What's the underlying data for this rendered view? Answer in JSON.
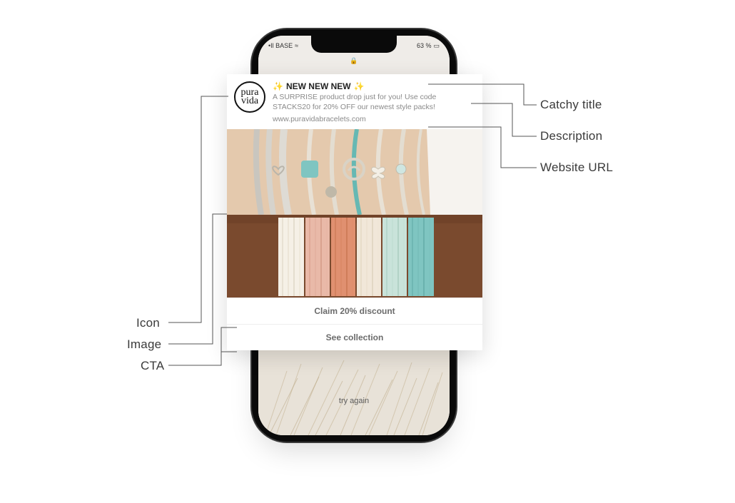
{
  "status_bar": {
    "carrier": "•Il BASE",
    "wifi_glyph": "≈",
    "battery_text": "63 %",
    "battery_glyph": "▭"
  },
  "phone_ui": {
    "lock_glyph": "🔒",
    "try_again": "try again"
  },
  "brand": {
    "line1": "pura",
    "line2": "vida"
  },
  "notification": {
    "sparkle": "✨",
    "title": "NEW NEW NEW",
    "description": "A SURPRISE product drop just for you! Use code STACKS20 for 20% OFF our newest style packs!",
    "url": "www.puravidabracelets.com",
    "cta_primary": "Claim 20% discount",
    "cta_secondary": "See collection"
  },
  "callouts": {
    "left": [
      "Icon",
      "Image",
      "CTA"
    ],
    "right": [
      "Catchy title",
      "Description",
      "Website URL"
    ]
  },
  "palette": {
    "white": "#ffffff",
    "arm_top": "#e4c9ad",
    "arm_bottom": "#7a4a2e",
    "silver": "#d9d7d2",
    "turquoise": "#7fc5c1",
    "dusty_pink": "#e9b9a8",
    "coral": "#e09070",
    "cream": "#f1e7d9",
    "mint": "#c9e3da"
  }
}
